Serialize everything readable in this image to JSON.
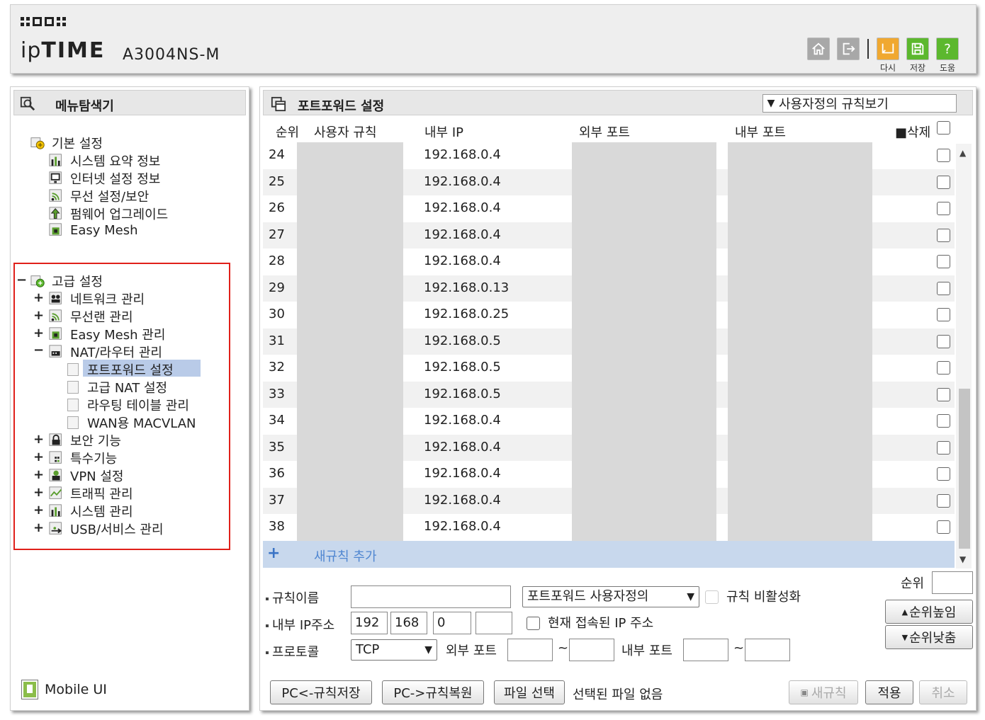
{
  "header": {
    "brand_prefix": "ip",
    "brand_main": "TIME",
    "model": "A3004NS-M",
    "buttons": [
      {
        "name": "home",
        "label": ""
      },
      {
        "name": "logout",
        "label": ""
      },
      {
        "name": "redo",
        "label": "다시"
      },
      {
        "name": "save",
        "label": "저장"
      },
      {
        "name": "help",
        "label": "도움"
      }
    ],
    "colors": {
      "redo": "#f0a830",
      "save": "#5cb82e",
      "help": "#5cb82e"
    }
  },
  "sidebar": {
    "title": "메뉴탐색기",
    "basic": {
      "label": "기본 설정",
      "items": [
        "시스템 요약 정보",
        "인터넷 설정 정보",
        "무선 설정/보안",
        "펌웨어 업그레이드",
        "Easy Mesh"
      ]
    },
    "advanced": {
      "expander": "−",
      "label": "고급 설정",
      "items": [
        {
          "expander": "+",
          "label": "네트워크 관리"
        },
        {
          "expander": "+",
          "label": "무선랜 관리"
        },
        {
          "expander": "+",
          "label": "Easy Mesh 관리"
        },
        {
          "expander": "−",
          "label": "NAT/라우터 관리"
        },
        {
          "expander": "+",
          "label": "보안 기능"
        },
        {
          "expander": "+",
          "label": "특수기능"
        },
        {
          "expander": "+",
          "label": "VPN 설정"
        },
        {
          "expander": "+",
          "label": "트래픽 관리"
        },
        {
          "expander": "+",
          "label": "시스템 관리"
        },
        {
          "expander": "+",
          "label": "USB/서비스 관리"
        }
      ],
      "nat_children": [
        "포트포워드 설정",
        "고급 NAT 설정",
        "라우팅 테이블 관리",
        "WAN용 MACVLAN"
      ],
      "selected": "포트포워드 설정"
    },
    "mobile_ui": "Mobile UI",
    "highlight_color": "#e0201a"
  },
  "main": {
    "title": "포트포워드 설정",
    "view_select": "사용자정의 규칙보기",
    "columns": {
      "order": "순위",
      "rule": "사용자 규칙",
      "internal_ip": "내부 IP",
      "external_port": "외부 포트",
      "internal_port": "내부 포트",
      "delete": "삭제"
    },
    "rows": [
      {
        "no": "24",
        "ip": "192.168.0.4"
      },
      {
        "no": "25",
        "ip": "192.168.0.4"
      },
      {
        "no": "26",
        "ip": "192.168.0.4"
      },
      {
        "no": "27",
        "ip": "192.168.0.4"
      },
      {
        "no": "28",
        "ip": "192.168.0.4"
      },
      {
        "no": "29",
        "ip": "192.168.0.13"
      },
      {
        "no": "30",
        "ip": "192.168.0.25"
      },
      {
        "no": "31",
        "ip": "192.168.0.5"
      },
      {
        "no": "32",
        "ip": "192.168.0.5"
      },
      {
        "no": "33",
        "ip": "192.168.0.5"
      },
      {
        "no": "34",
        "ip": "192.168.0.4"
      },
      {
        "no": "35",
        "ip": "192.168.0.4"
      },
      {
        "no": "36",
        "ip": "192.168.0.4"
      },
      {
        "no": "37",
        "ip": "192.168.0.4"
      },
      {
        "no": "38",
        "ip": "192.168.0.4"
      }
    ],
    "new_rule_plus": "+",
    "new_rule": "새규칙 추가",
    "form": {
      "rule_name_label": "규칙이름",
      "rule_name_value": "",
      "type_select": "포트포워드 사용자정의",
      "disable_label": "규칙 비활성화",
      "order_label": "순위",
      "order_value": "",
      "internal_ip_label": "내부 IP주소",
      "ip1": "192",
      "ip2": "168",
      "ip3": "0",
      "ip4": "",
      "current_ip_label": "현재 접속된 IP 주소",
      "protocol_label": "프로토콜",
      "protocol_value": "TCP",
      "external_port_label": "외부 포트",
      "internal_port_label": "내부 포트",
      "range_sep": "~",
      "priority_up": "순위높임",
      "priority_down": "순위낮춤"
    },
    "buttons": {
      "pc_save": "PC<-규칙저장",
      "pc_restore": "PC->규칙복원",
      "file_select": "파일 선택",
      "no_file": "선택된 파일 없음",
      "new_rule": "새규칙",
      "apply": "적용",
      "cancel": "취소"
    }
  }
}
